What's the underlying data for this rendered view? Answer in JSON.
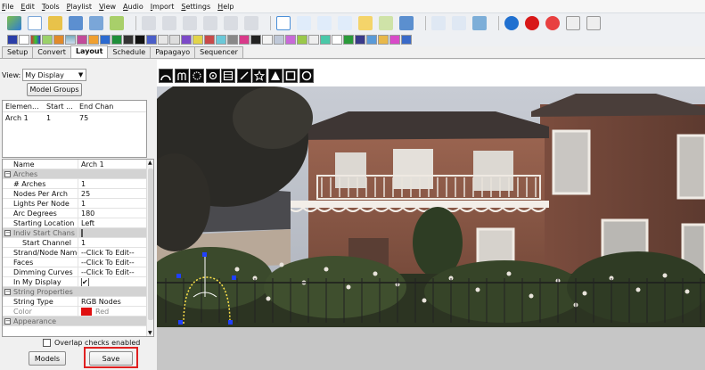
{
  "menu": [
    "File",
    "Edit",
    "Tools",
    "Playlist",
    "View",
    "Audio",
    "Import",
    "Settings",
    "Help"
  ],
  "tabs": [
    {
      "label": "Setup",
      "active": false
    },
    {
      "label": "Convert",
      "active": false
    },
    {
      "label": "Layout",
      "active": true
    },
    {
      "label": "Schedule",
      "active": false
    },
    {
      "label": "Papagayo",
      "active": false
    },
    {
      "label": "Sequencer",
      "active": false
    }
  ],
  "view": {
    "label": "View:",
    "selected": "My Display"
  },
  "buttons": {
    "model_groups": "Model Groups",
    "models": "Models",
    "save": "Save"
  },
  "element_list": {
    "columns": [
      "Elemen...",
      "Start ...",
      "End Chan"
    ],
    "rows": [
      [
        "Arch 1",
        "1",
        "75"
      ]
    ]
  },
  "properties": [
    {
      "kind": "row",
      "key": "Name",
      "value": "Arch 1"
    },
    {
      "kind": "cat",
      "key": "Arches"
    },
    {
      "kind": "row",
      "key": "# Arches",
      "value": "1"
    },
    {
      "kind": "row",
      "key": "Nodes Per Arch",
      "value": "25"
    },
    {
      "kind": "row",
      "key": "Lights Per Node",
      "value": "1"
    },
    {
      "kind": "row",
      "key": "Arc Degrees",
      "value": "180"
    },
    {
      "kind": "row",
      "key": "Starting Location",
      "value": "Left"
    },
    {
      "kind": "cat-check",
      "key": "Indiv Start Chans",
      "checked": false
    },
    {
      "kind": "sub",
      "key": "Start Channel",
      "value": "1"
    },
    {
      "kind": "row",
      "key": "Strand/Node Names",
      "value": "--Click To Edit--"
    },
    {
      "kind": "row",
      "key": "Faces",
      "value": "--Click To Edit--"
    },
    {
      "kind": "row",
      "key": "Dimming Curves",
      "value": "--Click To Edit--"
    },
    {
      "kind": "check",
      "key": "In My Display",
      "checked": true
    },
    {
      "kind": "cat",
      "key": "String Properties"
    },
    {
      "kind": "row",
      "key": "String Type",
      "value": "RGB Nodes"
    },
    {
      "kind": "color",
      "key": "Color",
      "value": "Red",
      "color": "#e01010"
    },
    {
      "kind": "cat",
      "key": "Appearance"
    }
  ],
  "overlap_label": "Overlap checks enabled",
  "overlap_checked": false,
  "icons": {
    "toolbar": [
      "render-icon",
      "new-sequence-icon",
      "open-sequence-icon",
      "save-icon",
      "save-as-icon",
      "render-all-icon",
      "play-icon",
      "pause-icon",
      "stop-icon",
      "first-frame-icon",
      "last-frame-icon",
      "replay-icon",
      "lights-off-icon",
      "zoom-in-icon",
      "zoom-out-icon",
      "settings-icon",
      "info-icon",
      "stop-sign-icon",
      "stop-output-icon",
      "help-icon",
      "pin-icon"
    ],
    "shapes": [
      "arch-icon",
      "candy-cane-icon",
      "circle-icon",
      "star-spinner-icon",
      "matrix-icon",
      "single-line-icon",
      "star-icon",
      "tree-icon",
      "window-frame-icon",
      "wreath-icon"
    ]
  },
  "accent": {
    "highlight": "#e02020",
    "model_line": "#ffe24a",
    "node": "#2040ff"
  }
}
